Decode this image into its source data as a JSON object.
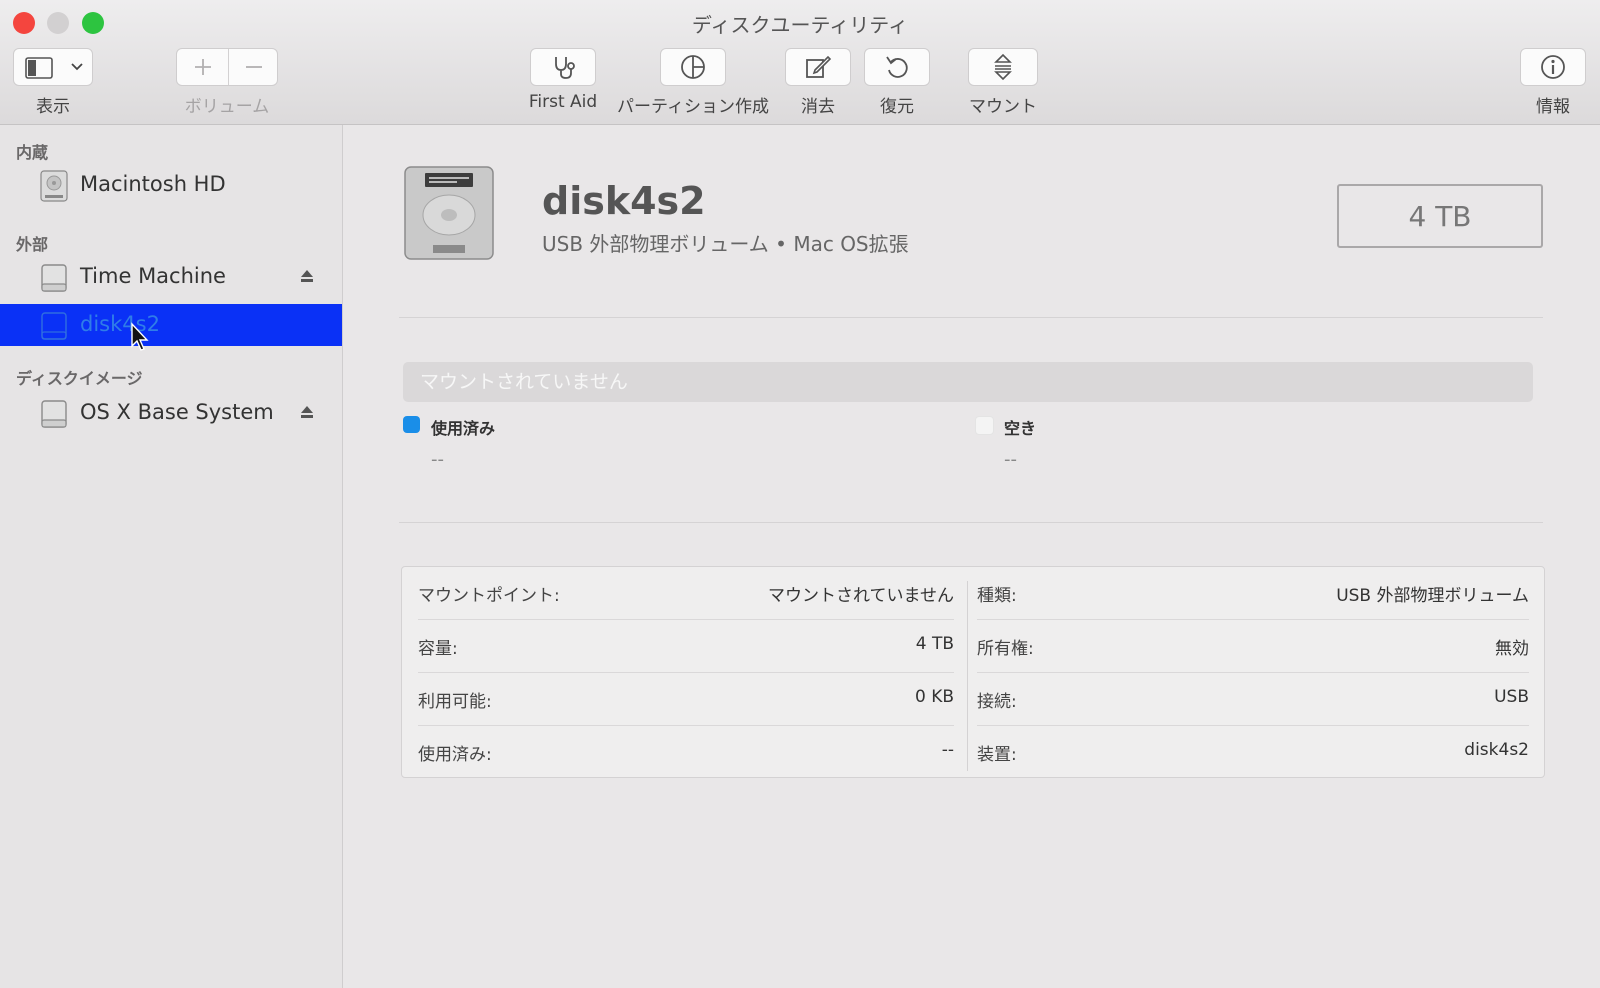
{
  "window": {
    "title": "ディスクユーティリティ"
  },
  "toolbar": {
    "view_label": "表示",
    "volume_label": "ボリューム",
    "first_aid_label": "First Aid",
    "partition_label": "パーティション作成",
    "erase_label": "消去",
    "restore_label": "復元",
    "mount_label": "マウント",
    "info_label": "情報"
  },
  "sidebar": {
    "sections": [
      {
        "label": "内蔵"
      },
      {
        "label": "外部"
      },
      {
        "label": "ディスクイメージ"
      }
    ],
    "items": [
      {
        "label": "Macintosh HD"
      },
      {
        "label": "Time Machine"
      },
      {
        "label": "disk4s2"
      },
      {
        "label": "OS X Base System"
      }
    ]
  },
  "detail": {
    "name": "disk4s2",
    "subtitle": "USB 外部物理ボリューム • Mac OS拡張",
    "size": "4 TB",
    "usage_bar_text": "マウントされていません",
    "legend": [
      {
        "label": "使用済み",
        "value": "--",
        "color": "#1a8ee8"
      },
      {
        "label": "空き",
        "value": "--",
        "color": "#f4f4f4"
      }
    ]
  },
  "info": {
    "left": [
      {
        "key": "マウントポイント:",
        "value": "マウントされていません"
      },
      {
        "key": "容量:",
        "value": "4 TB"
      },
      {
        "key": "利用可能:",
        "value": "0 KB"
      },
      {
        "key": "使用済み:",
        "value": "--"
      }
    ],
    "right": [
      {
        "key": "種類:",
        "value": "USB 外部物理ボリューム"
      },
      {
        "key": "所有権:",
        "value": "無効"
      },
      {
        "key": "接続:",
        "value": "USB"
      },
      {
        "key": "装置:",
        "value": "disk4s2"
      }
    ]
  },
  "colors": {
    "selection": "#0a31f6",
    "close": "#f4453e",
    "zoom": "#2dc440"
  }
}
